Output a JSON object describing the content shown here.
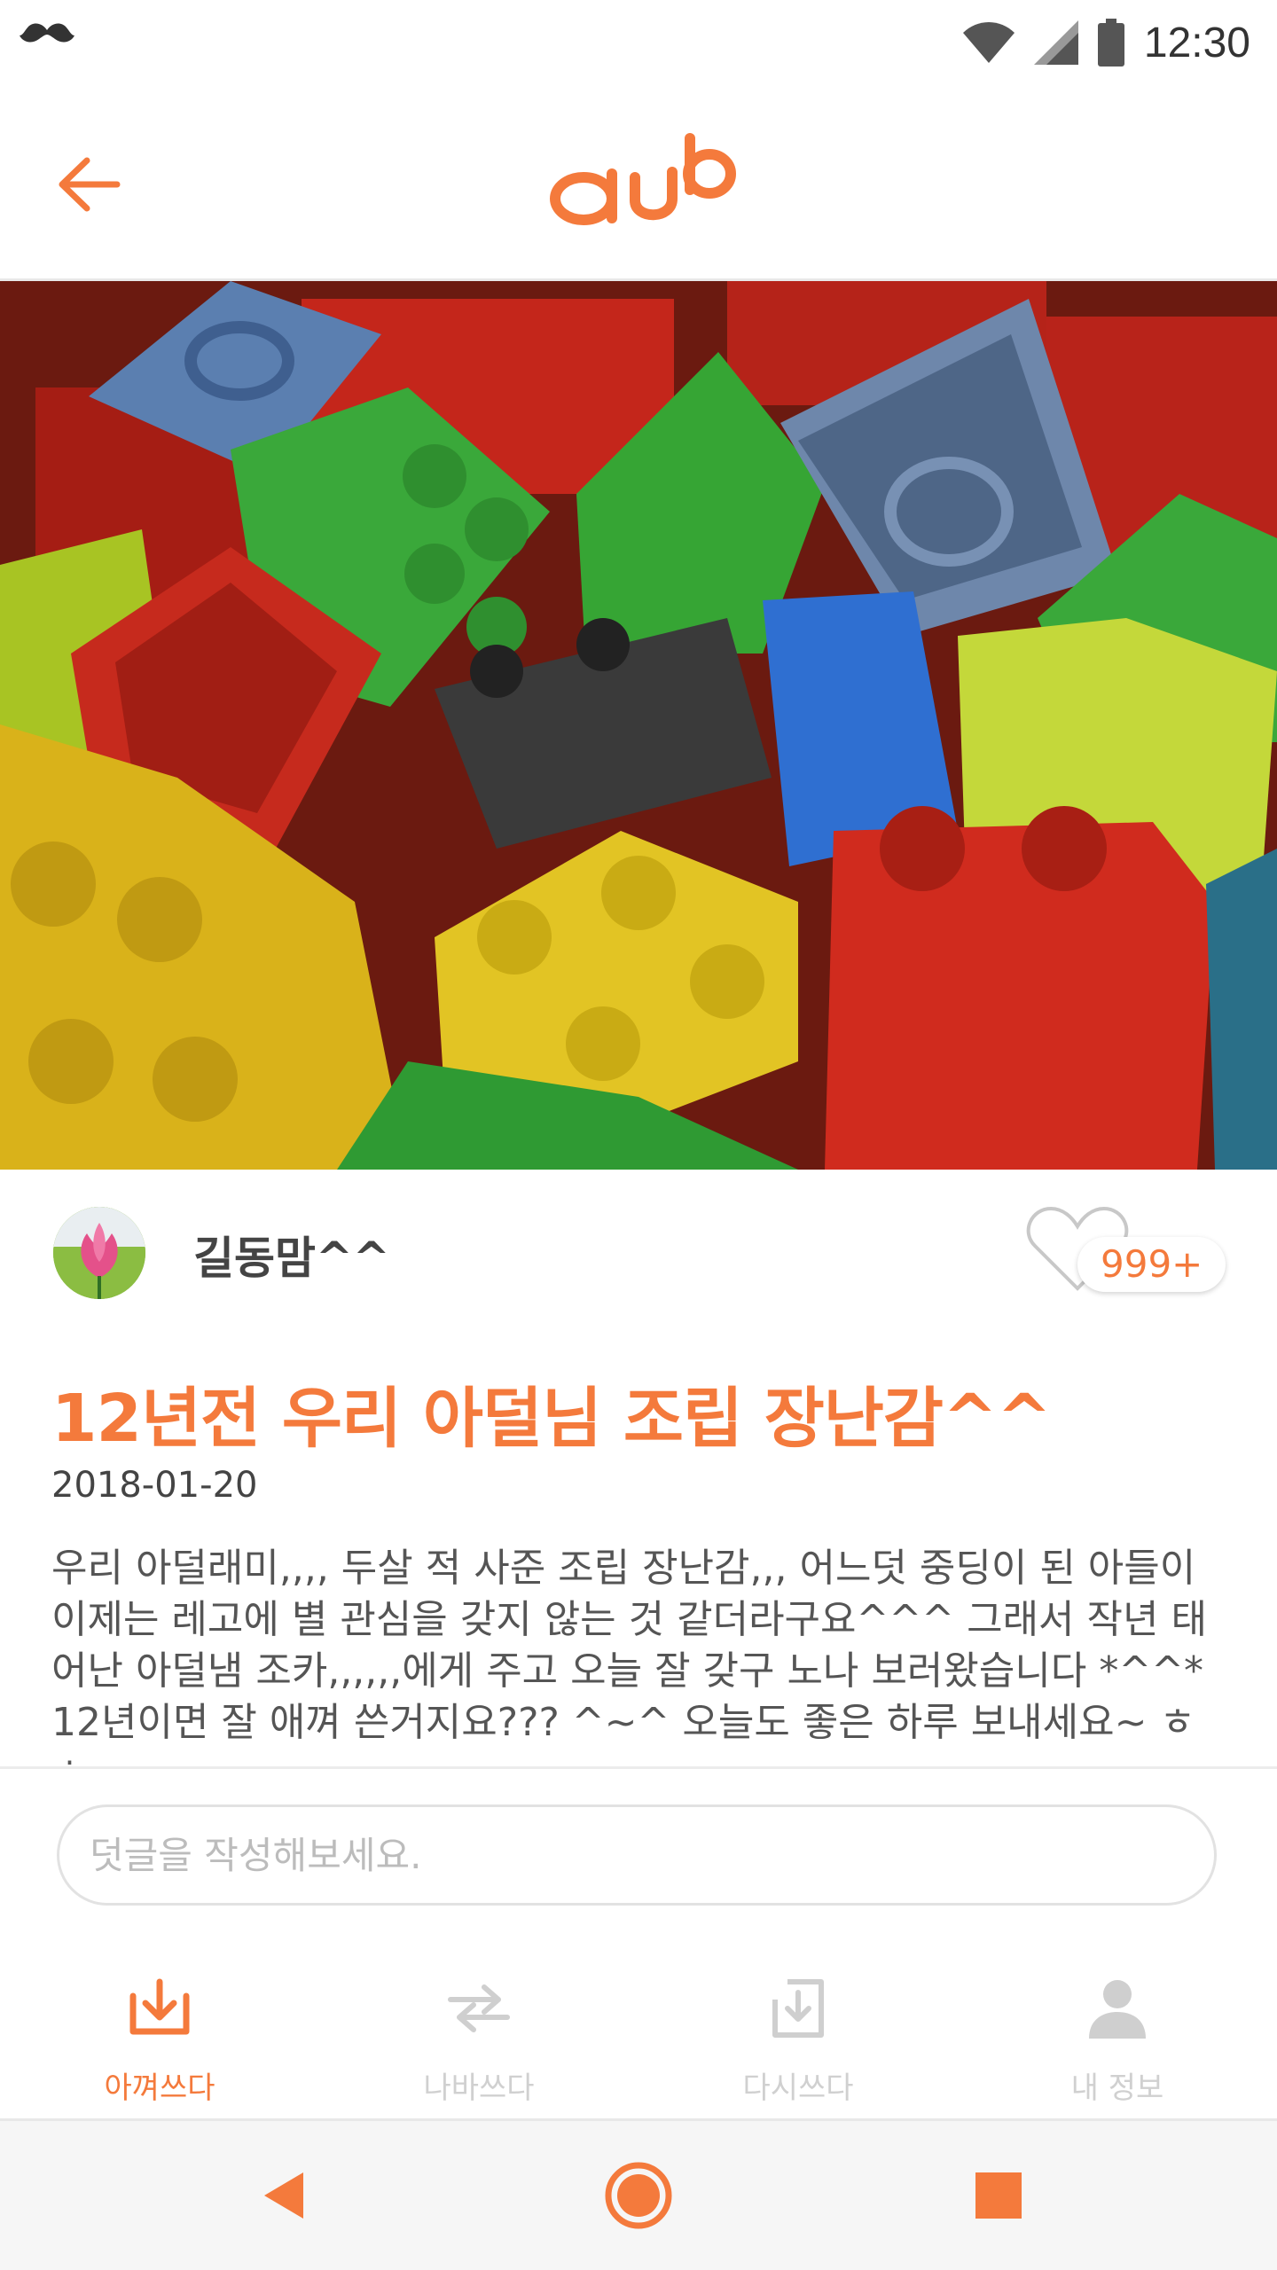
{
  "status_bar": {
    "time": "12:30"
  },
  "header": {
    "logo_text": "ounb"
  },
  "author": {
    "name": "길동맘^^"
  },
  "likes": {
    "count": "999+"
  },
  "post": {
    "title": "12년전 우리 아덜님 조립 장난감^^",
    "date": "2018-01-20",
    "body": "우리 아덜래미,,,, 두살 적 사준 조립 장난감,,, 어느덧 중딩이 된 아들이 이제는 레고에 별 관심을 갖지 않는 것 같더라구요^^^ 그래서 작년 태어난 아덜냄 조카,,,,,,에게 주고 오늘 잘 갖구 노나 보러왔습니다 *^^* 12년이면 잘 애껴 쓴거지요??? ^~^ 오늘도 좋은 하루 보내세요~ ㅎㅎ"
  },
  "comment": {
    "placeholder": "덧글을 작성해보세요."
  },
  "bottom_nav": [
    {
      "label": "아껴쓰다",
      "active": true
    },
    {
      "label": "나바쓰다",
      "active": false
    },
    {
      "label": "다시쓰다",
      "active": false
    },
    {
      "label": "내 정보",
      "active": false
    }
  ],
  "colors": {
    "accent": "#f47a3c",
    "inactive": "#d0d0d0"
  }
}
